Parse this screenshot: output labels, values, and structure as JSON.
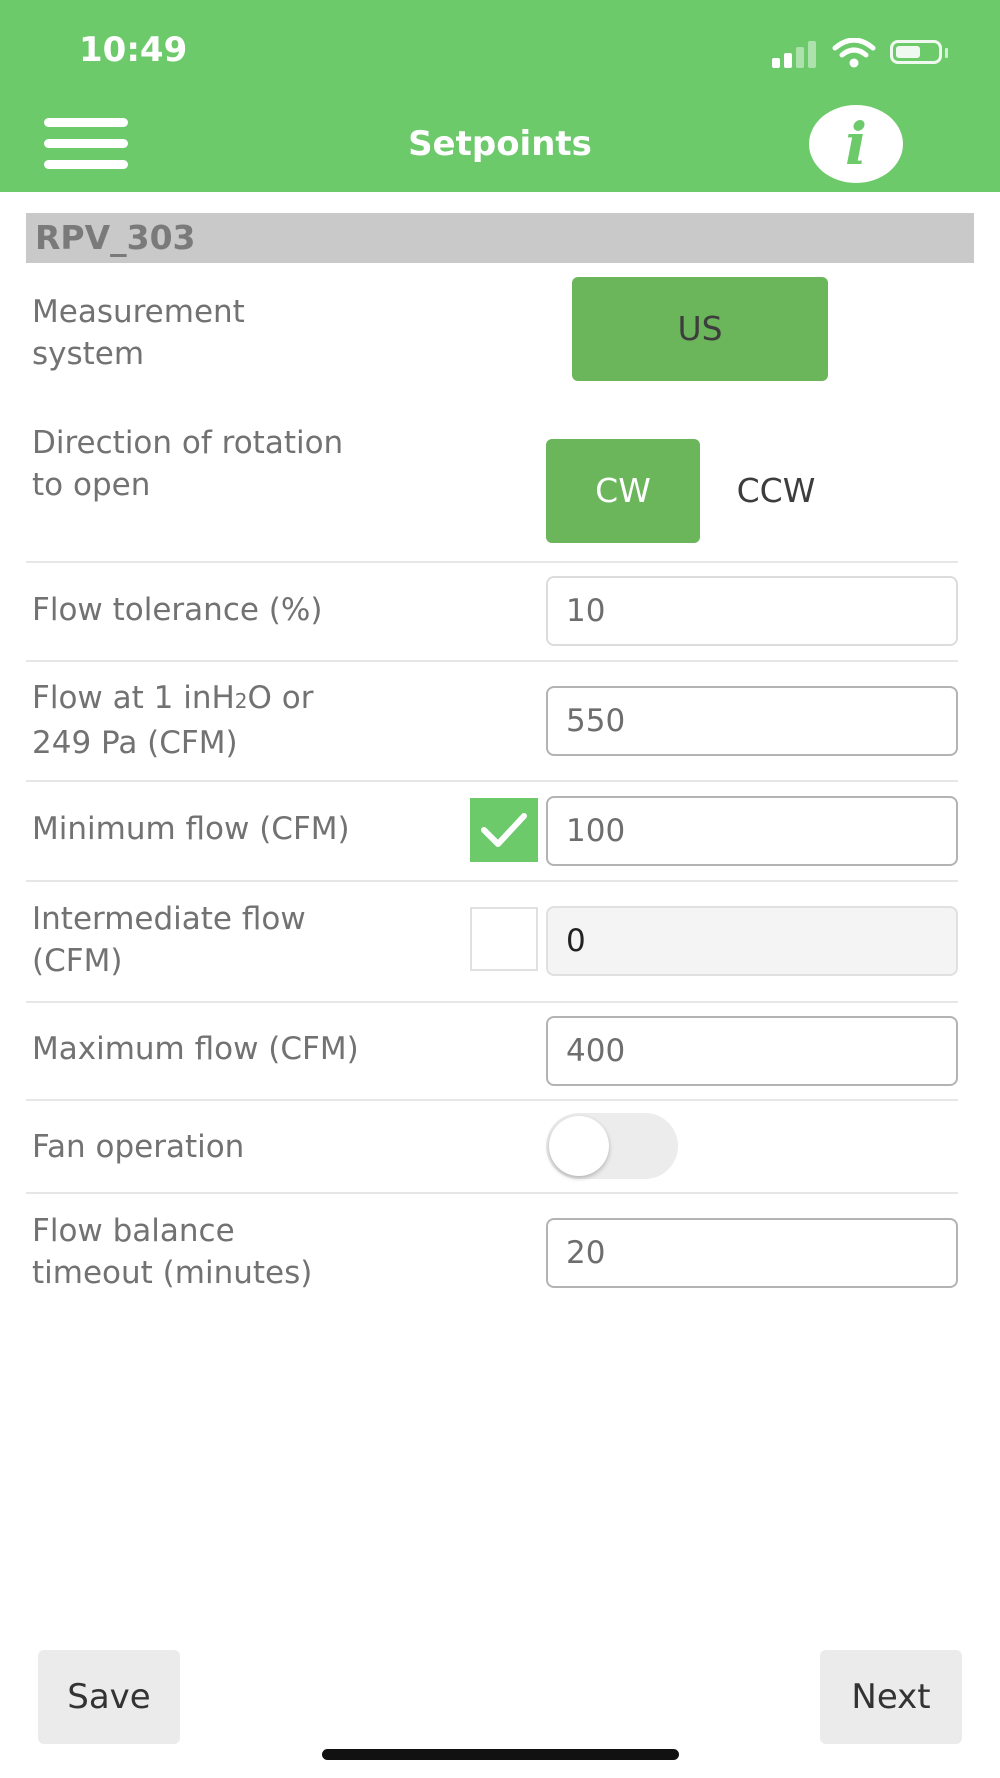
{
  "status_bar": {
    "time": "10:49"
  },
  "header": {
    "title": "Setpoints",
    "info_glyph": "i",
    "color": "#6cca6b"
  },
  "device": {
    "name": "RPV_303"
  },
  "measurement_system": {
    "label_line1": "Measurement",
    "label_line2": "system",
    "button": "US"
  },
  "rotation": {
    "label_line1": "Direction of rotation",
    "label_line2": "to open",
    "options": [
      "CW",
      "CCW"
    ],
    "selected": "CW"
  },
  "flow_tolerance": {
    "label": "Flow tolerance (%)",
    "value": "10"
  },
  "flow_reference": {
    "label_pre": "Flow at 1 inH",
    "label_sub": "2",
    "label_post": "O or",
    "label_line2": "249 Pa (CFM)",
    "value": "550"
  },
  "minimum_flow": {
    "label": "Minimum flow (CFM)",
    "checked": true,
    "value": "100"
  },
  "intermediate_flow": {
    "label_line1": "Intermediate flow",
    "label_line2": "(CFM)",
    "checked": false,
    "value": "0"
  },
  "maximum_flow": {
    "label": "Maximum flow (CFM)",
    "value": "400"
  },
  "fan_operation": {
    "label": "Fan operation",
    "enabled": false
  },
  "flow_balance_timeout": {
    "label_line1": "Flow balance",
    "label_line2": "timeout (minutes)",
    "value": "20"
  },
  "footer": {
    "save_label": "Save",
    "next_label": "Next"
  },
  "colors": {
    "accent": "#6cca6b",
    "button_green": "#6bb55a",
    "device_bar": "#c9c9c9"
  }
}
